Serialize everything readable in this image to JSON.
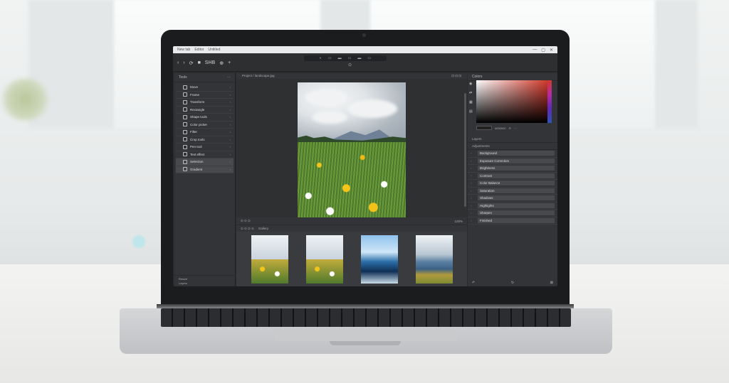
{
  "titlebar": {
    "tabs": [
      "New tab",
      "Editor",
      "Untitled"
    ],
    "controls": [
      "—",
      "▢",
      "✕"
    ]
  },
  "toolbar": {
    "left_icons": [
      "‹",
      "›",
      "⟳",
      "■",
      "SHB",
      "⊕",
      "+"
    ],
    "center_icons": [
      "◐",
      "▭",
      "▬",
      "▭",
      "▬",
      "▭"
    ],
    "zoom": "⊙"
  },
  "left_panel": {
    "title": "Tools",
    "tools": [
      {
        "label": "Move",
        "active": false
      },
      {
        "label": "Frame",
        "active": false
      },
      {
        "label": "Transform",
        "active": false
      },
      {
        "label": "Rectangle",
        "active": false
      },
      {
        "label": "Shape tools",
        "active": false
      },
      {
        "label": "Color picker",
        "active": false
      },
      {
        "label": "Filter",
        "active": false
      },
      {
        "label": "Crop tools",
        "active": false
      },
      {
        "label": "Pen tool",
        "active": false
      },
      {
        "label": "Text effect",
        "active": false
      },
      {
        "label": "Selection",
        "active": true
      },
      {
        "label": "Gradient",
        "active": true
      }
    ],
    "footer": [
      "Resize",
      "Layers"
    ]
  },
  "canvas": {
    "crumb": "Project / landscape.jpg",
    "crumb_right": "⊡ ⊡ ⊡",
    "footer_left": "⊙ ⊙ ⊙",
    "footer_right": "100%"
  },
  "filmstrip": {
    "title": "Gallery"
  },
  "right_panel": {
    "title": "Colors",
    "hex": "#000000",
    "layers_title": "Layers",
    "layers_sub": "Adjustments",
    "layers": [
      "Background",
      "Exposure Correction",
      "Brightness",
      "Contrast",
      "Color Balance",
      "Saturation",
      "Shadows",
      "Highlights",
      "Sharpen",
      "Finished"
    ]
  }
}
